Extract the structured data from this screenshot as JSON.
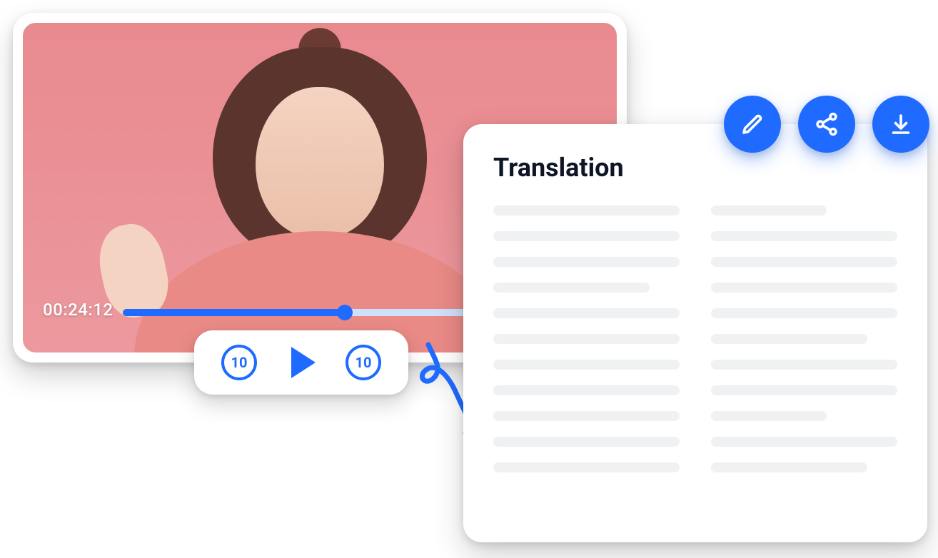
{
  "player": {
    "timestamp": "00:24:12",
    "progress_pct": 44,
    "rewind_label": "10",
    "forward_label": "10"
  },
  "translation": {
    "title": "Translation"
  },
  "actions": {
    "edit_name": "edit",
    "share_name": "share",
    "download_name": "download"
  },
  "colors": {
    "accent": "#1f6bff"
  }
}
